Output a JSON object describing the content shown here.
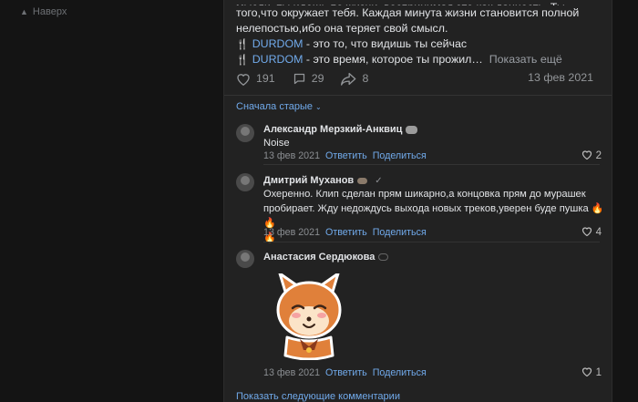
{
  "nav": {
    "back_label": "Наверх"
  },
  "post": {
    "lines": [
      "мысли, ты идешь по жизни, воспринимая это как данность. Ты",
      "того,что окружает тебя. Каждая минута жизни становится полной",
      "нелепостью,ибо она теряет свой смысл."
    ],
    "promo1_link": "DURDOM",
    "promo1_text": " - это то, что видишь ты сейчас",
    "promo2_link": "DURDOM",
    "promo2_text": " - это время, которое ты прожил",
    "show_more": "Показать ещё",
    "likes": "191",
    "comments": "29",
    "shares": "8",
    "date": "13 фев 2021"
  },
  "sort_label": "Сначала старые",
  "comments": [
    {
      "author": "Александр Мерзкий-Анквиц",
      "text": "Noise",
      "date": "13 фев 2021",
      "reply": "Ответить",
      "share": "Поделиться",
      "likes": "2"
    },
    {
      "author": "Дмитрий Муханов",
      "text_line1": "Охеренно. Клип сделан прям шикарно,а концовка прям до мурашек",
      "text_line2": "пробирает. Жду недождусь выхода новых треков,уверен буде пушка",
      "date": "13 фев 2021",
      "reply": "Ответить",
      "share": "Поделиться",
      "likes": "4"
    },
    {
      "author": "Анастасия Сердюкова",
      "date": "13 фев 2021",
      "reply": "Ответить",
      "share": "Поделиться",
      "likes": "1"
    }
  ],
  "show_next_label": "Показать следующие комментарии",
  "colors": {
    "accent": "#71aaeb",
    "card": "#222222",
    "page": "#141414"
  }
}
